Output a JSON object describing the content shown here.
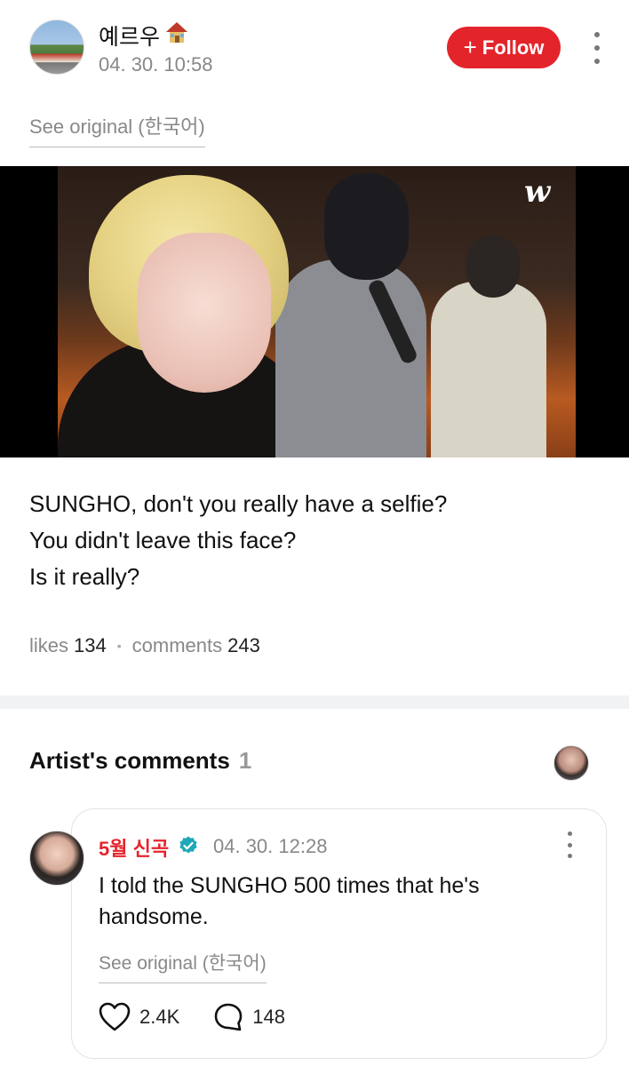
{
  "post": {
    "author": "예르우",
    "timestamp": "04. 30. 10:58",
    "follow_label": "Follow",
    "see_original": "See original (한국어)",
    "watermark": "w",
    "caption_lines": [
      "SUNGHO, don't you really have a selfie?",
      "You didn't leave this face?",
      "Is it really?"
    ],
    "likes_label": "likes",
    "likes_count": "134",
    "comments_label": "comments",
    "comments_count": "243"
  },
  "artist_comments": {
    "title": "Artist's comments",
    "count": "1"
  },
  "comment": {
    "author": "5월 신곡",
    "timestamp": "04. 30. 12:28",
    "text": "I told the SUNGHO 500 times that he's handsome.",
    "see_original": "See original (한국어)",
    "likes": "2.4K",
    "replies": "148"
  },
  "colors": {
    "accent": "#e4242b",
    "verified": "#1fa8b8"
  }
}
